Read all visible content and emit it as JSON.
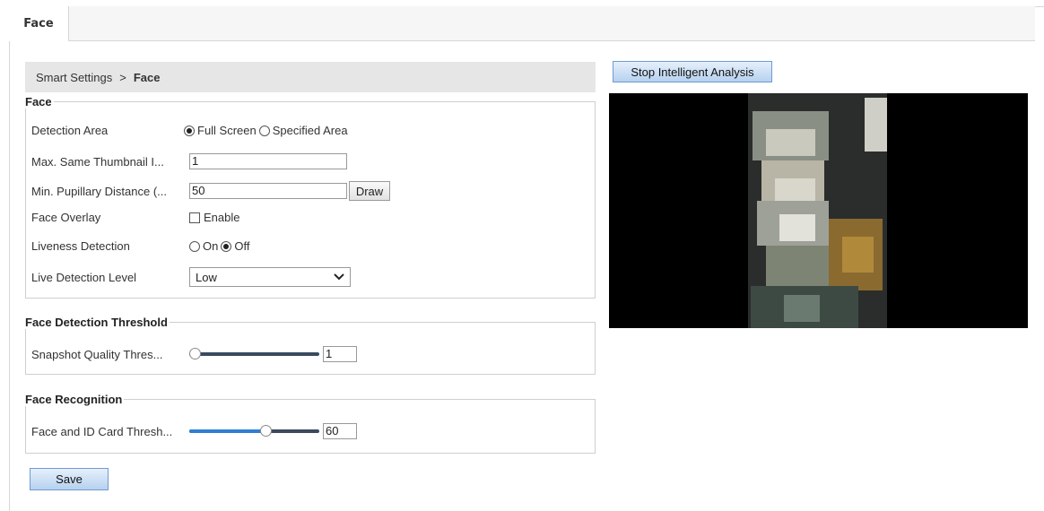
{
  "tabs": [
    {
      "label": "Face"
    }
  ],
  "breadcrumb": {
    "parent": "Smart Settings",
    "separator": ">",
    "current": "Face"
  },
  "face_section": {
    "legend": "Face",
    "detection_area": {
      "label": "Detection Area",
      "options": [
        "Full Screen",
        "Specified Area"
      ],
      "selected": "Full Screen"
    },
    "max_thumbnail": {
      "label": "Max. Same Thumbnail I...",
      "value": "1"
    },
    "min_pupillary": {
      "label": "Min. Pupillary Distance (...",
      "value": "50",
      "draw_label": "Draw"
    },
    "face_overlay": {
      "label": "Face Overlay",
      "checkbox_label": "Enable",
      "checked": false
    },
    "liveness": {
      "label": "Liveness Detection",
      "options": [
        "On",
        "Off"
      ],
      "selected": "Off"
    },
    "live_level": {
      "label": "Live Detection Level",
      "value": "Low"
    }
  },
  "threshold_section": {
    "legend": "Face Detection Threshold",
    "snapshot": {
      "label": "Snapshot Quality Thres...",
      "value": "1",
      "fraction": 0.0
    }
  },
  "recognition_section": {
    "legend": "Face Recognition",
    "id_card": {
      "label": "Face and ID Card Thresh...",
      "value": "60",
      "fraction": 0.6
    }
  },
  "save_label": "Save",
  "stop_label": "Stop Intelligent Analysis",
  "colors": {
    "accent": "#2f7fd1",
    "track": "#3a4a5e",
    "button_blue": "#b6d1ef"
  }
}
